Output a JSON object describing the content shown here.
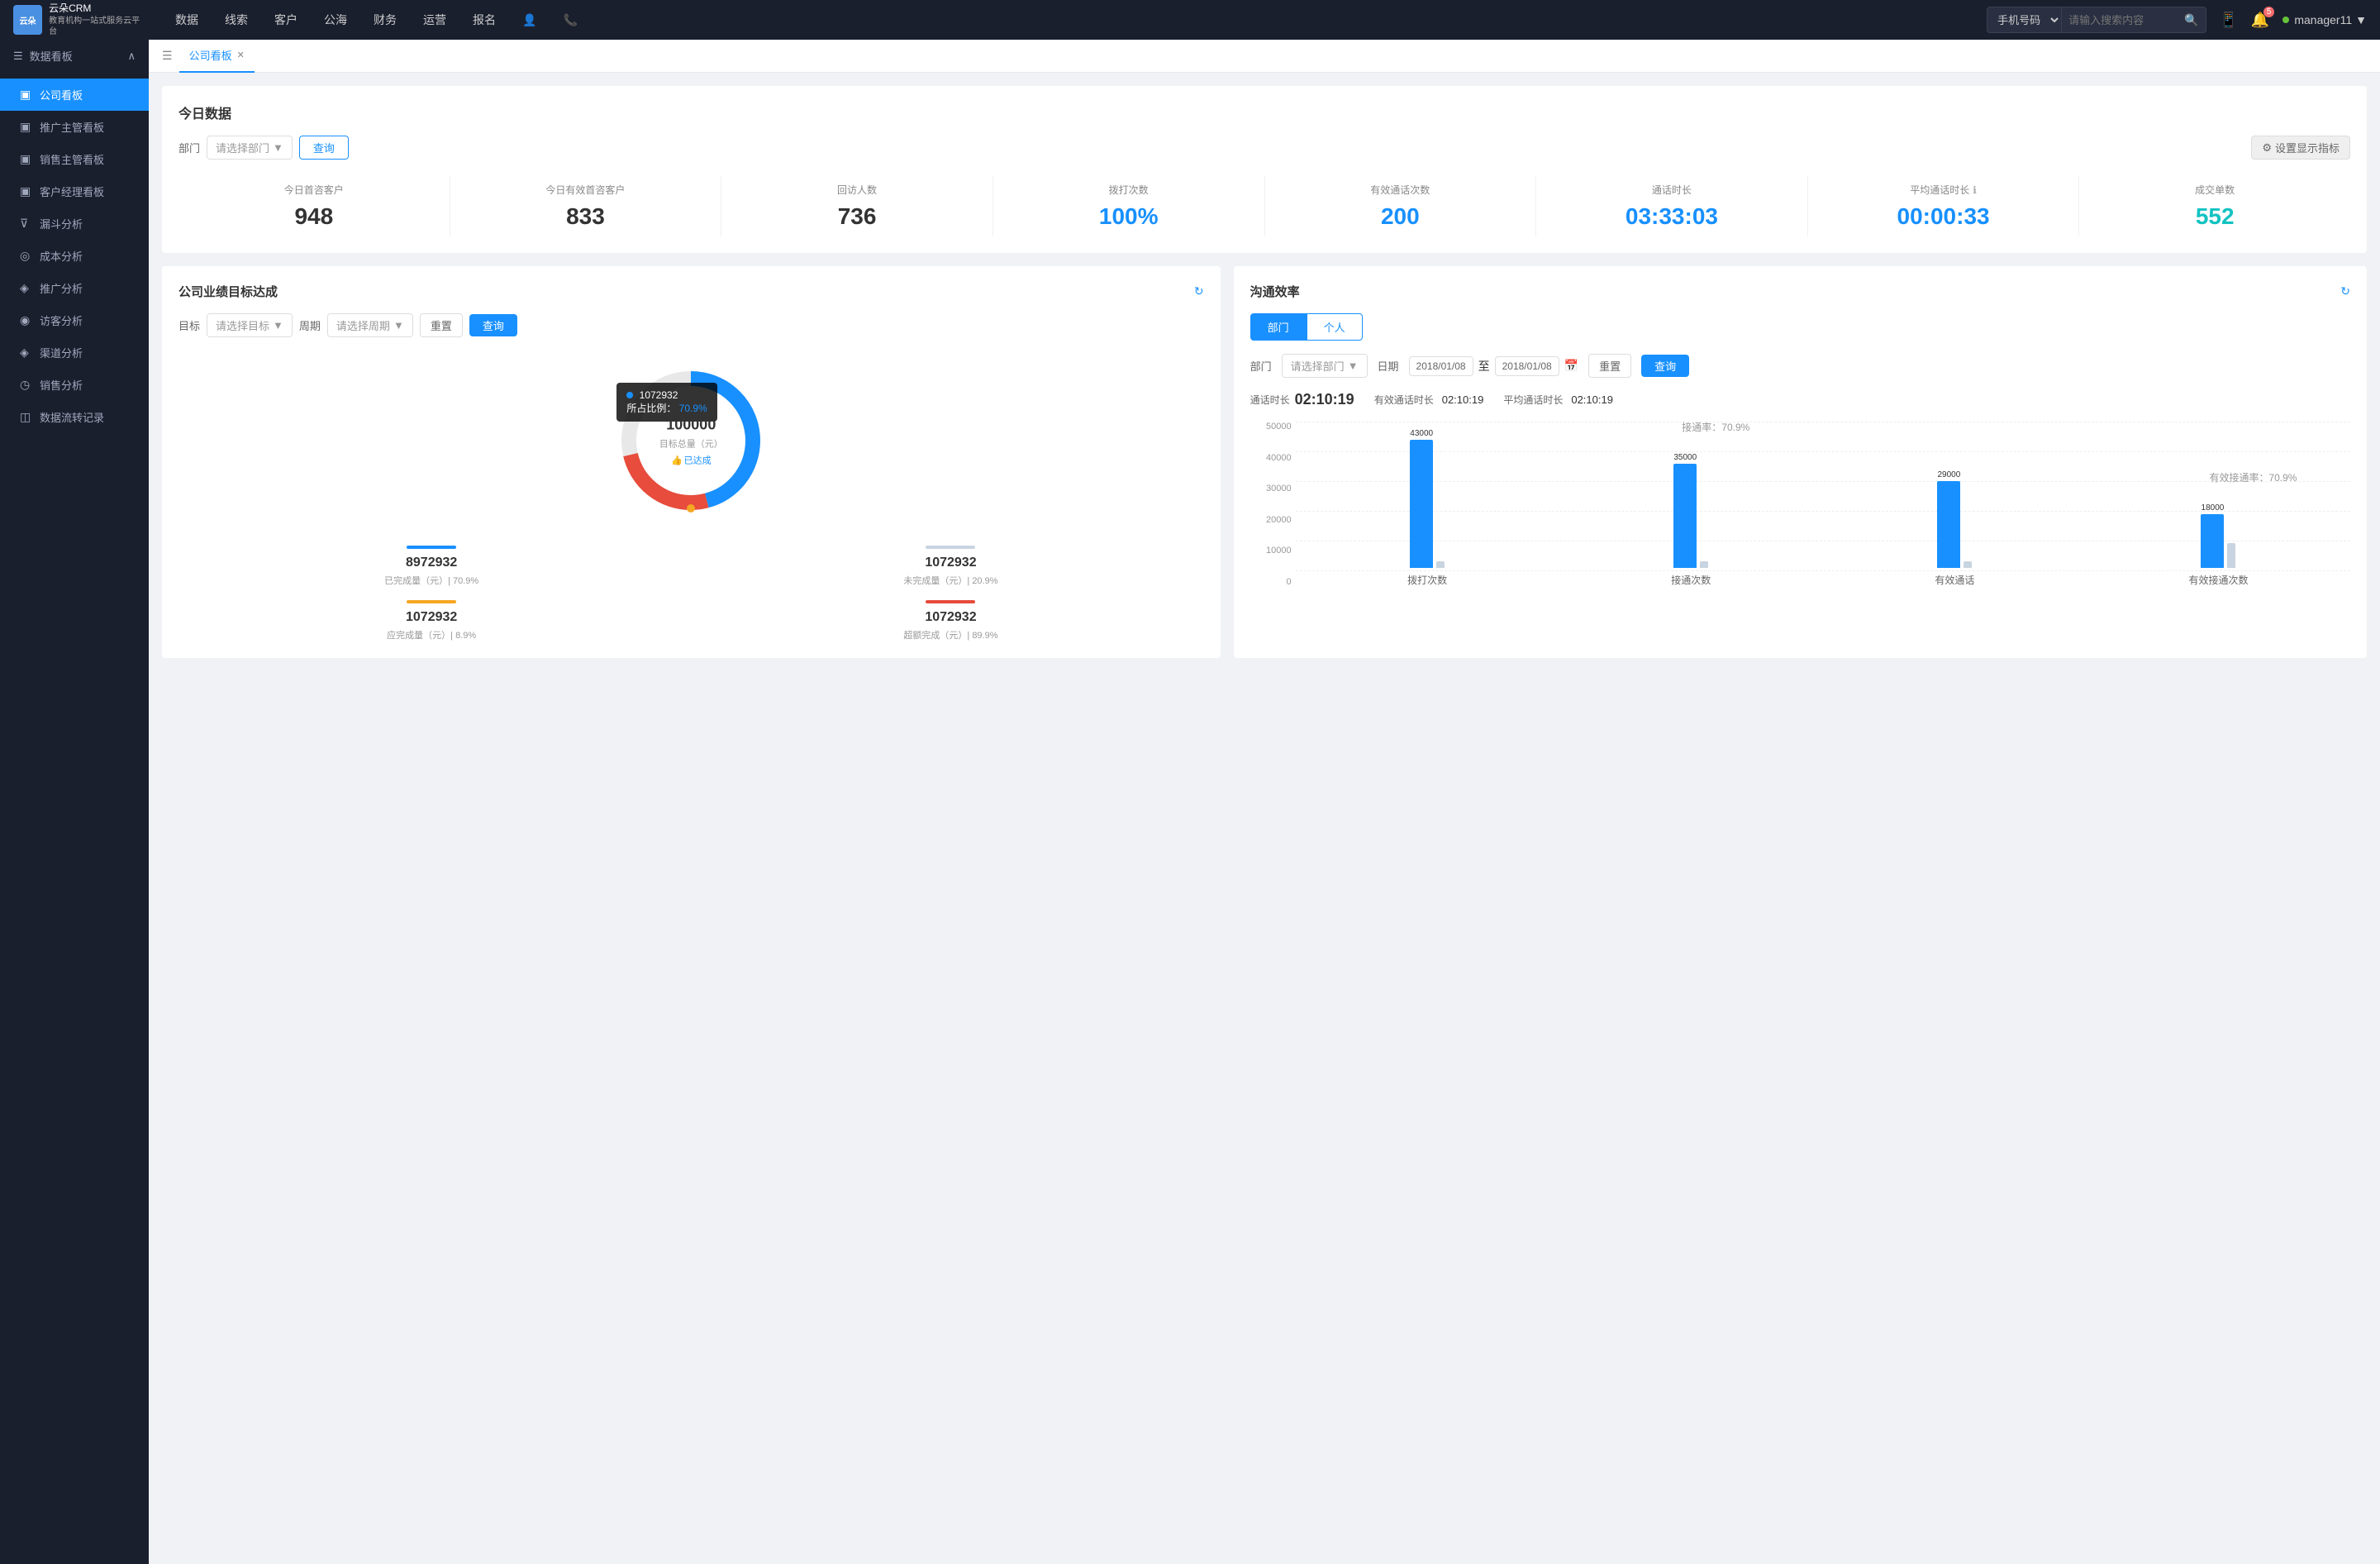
{
  "app": {
    "logo_line1": "云朵CRM",
    "logo_line2": "教育机构一站式服务云平台"
  },
  "topnav": {
    "items": [
      "数据",
      "线索",
      "客户",
      "公海",
      "财务",
      "运营",
      "报名"
    ],
    "search_placeholder": "请输入搜索内容",
    "search_select": "手机号码",
    "notification_count": "5",
    "username": "manager11"
  },
  "sidebar": {
    "section_label": "数据看板",
    "items": [
      {
        "label": "公司看板",
        "active": true
      },
      {
        "label": "推广主管看板",
        "active": false
      },
      {
        "label": "销售主管看板",
        "active": false
      },
      {
        "label": "客户经理看板",
        "active": false
      },
      {
        "label": "漏斗分析",
        "active": false
      },
      {
        "label": "成本分析",
        "active": false
      },
      {
        "label": "推广分析",
        "active": false
      },
      {
        "label": "访客分析",
        "active": false
      },
      {
        "label": "渠道分析",
        "active": false
      },
      {
        "label": "销售分析",
        "active": false
      },
      {
        "label": "数据流转记录",
        "active": false
      }
    ]
  },
  "tab": {
    "label": "公司看板"
  },
  "today": {
    "section_title": "今日数据",
    "filter_label": "部门",
    "select_placeholder": "请选择部门",
    "query_btn": "查询",
    "settings_btn": "设置显示指标",
    "metrics": [
      {
        "label": "今日首咨客户",
        "value": "948",
        "color": "black"
      },
      {
        "label": "今日有效首咨客户",
        "value": "833",
        "color": "black"
      },
      {
        "label": "回访人数",
        "value": "736",
        "color": "black"
      },
      {
        "label": "拨打次数",
        "value": "100%",
        "color": "blue"
      },
      {
        "label": "有效通话次数",
        "value": "200",
        "color": "blue"
      },
      {
        "label": "通话时长",
        "value": "03:33:03",
        "color": "blue"
      },
      {
        "label": "平均通话时长",
        "value": "00:00:33",
        "color": "blue"
      },
      {
        "label": "成交单数",
        "value": "552",
        "color": "cyan"
      }
    ]
  },
  "goal_panel": {
    "title": "公司业绩目标达成",
    "goal_label": "目标",
    "goal_placeholder": "请选择目标",
    "period_label": "周期",
    "period_placeholder": "请选择周期",
    "reset_btn": "重置",
    "query_btn": "查询",
    "chart": {
      "center_value": "100000",
      "center_label": "目标总量（元）",
      "center_badge": "已达成",
      "tooltip_value": "1072932",
      "tooltip_percent": "70.9%",
      "tooltip_prefix": "所占比例："
    },
    "stats": [
      {
        "label": "已完成量（元）| 70.9%",
        "value": "8972932",
        "color": "#1890ff"
      },
      {
        "label": "未完成量（元）| 20.9%",
        "value": "1072932",
        "color": "#c8d4e0"
      },
      {
        "label": "应完成量（元）| 8.9%",
        "value": "1072932",
        "color": "#f5a623"
      },
      {
        "label": "超额完成（元）| 89.9%",
        "value": "1072932",
        "color": "#e74c3c"
      }
    ]
  },
  "comm_panel": {
    "title": "沟通效率",
    "tabs": [
      "部门",
      "个人"
    ],
    "active_tab": 0,
    "filter_label": "部门",
    "dept_placeholder": "请选择部门",
    "date_label": "日期",
    "date_start": "2018/01/08",
    "date_end": "2018/01/08",
    "reset_btn": "重置",
    "query_btn": "查询",
    "stats": {
      "call_time_label": "通话时长",
      "call_time_value": "02:10:19",
      "eff_time_label": "有效通话时长",
      "eff_time_value": "02:10:19",
      "avg_time_label": "平均通话时长",
      "avg_time_value": "02:10:19"
    },
    "chart": {
      "y_labels": [
        "50000",
        "40000",
        "30000",
        "20000",
        "10000",
        "0"
      ],
      "groups": [
        {
          "label": "拨打次数",
          "bars": [
            {
              "value": 43000,
              "label": "43000",
              "type": "blue",
              "height": 155
            },
            {
              "value": 0,
              "label": "",
              "type": "light",
              "height": 10
            }
          ]
        },
        {
          "label": "接通次数",
          "connection_rate": "接通率：70.9%",
          "bars": [
            {
              "value": 35000,
              "label": "35000",
              "type": "blue",
              "height": 126
            },
            {
              "value": 0,
              "label": "",
              "type": "light",
              "height": 10
            }
          ]
        },
        {
          "label": "有效通话",
          "bars": [
            {
              "value": 29000,
              "label": "29000",
              "type": "blue",
              "height": 105
            },
            {
              "value": 0,
              "label": "",
              "type": "light",
              "height": 10
            }
          ]
        },
        {
          "label": "有效接通次数",
          "eff_rate": "有效接通率：70.9%",
          "bars": [
            {
              "value": 18000,
              "label": "18000",
              "type": "blue",
              "height": 65
            },
            {
              "value": 0,
              "label": "",
              "type": "light",
              "height": 10
            }
          ]
        }
      ]
    }
  }
}
